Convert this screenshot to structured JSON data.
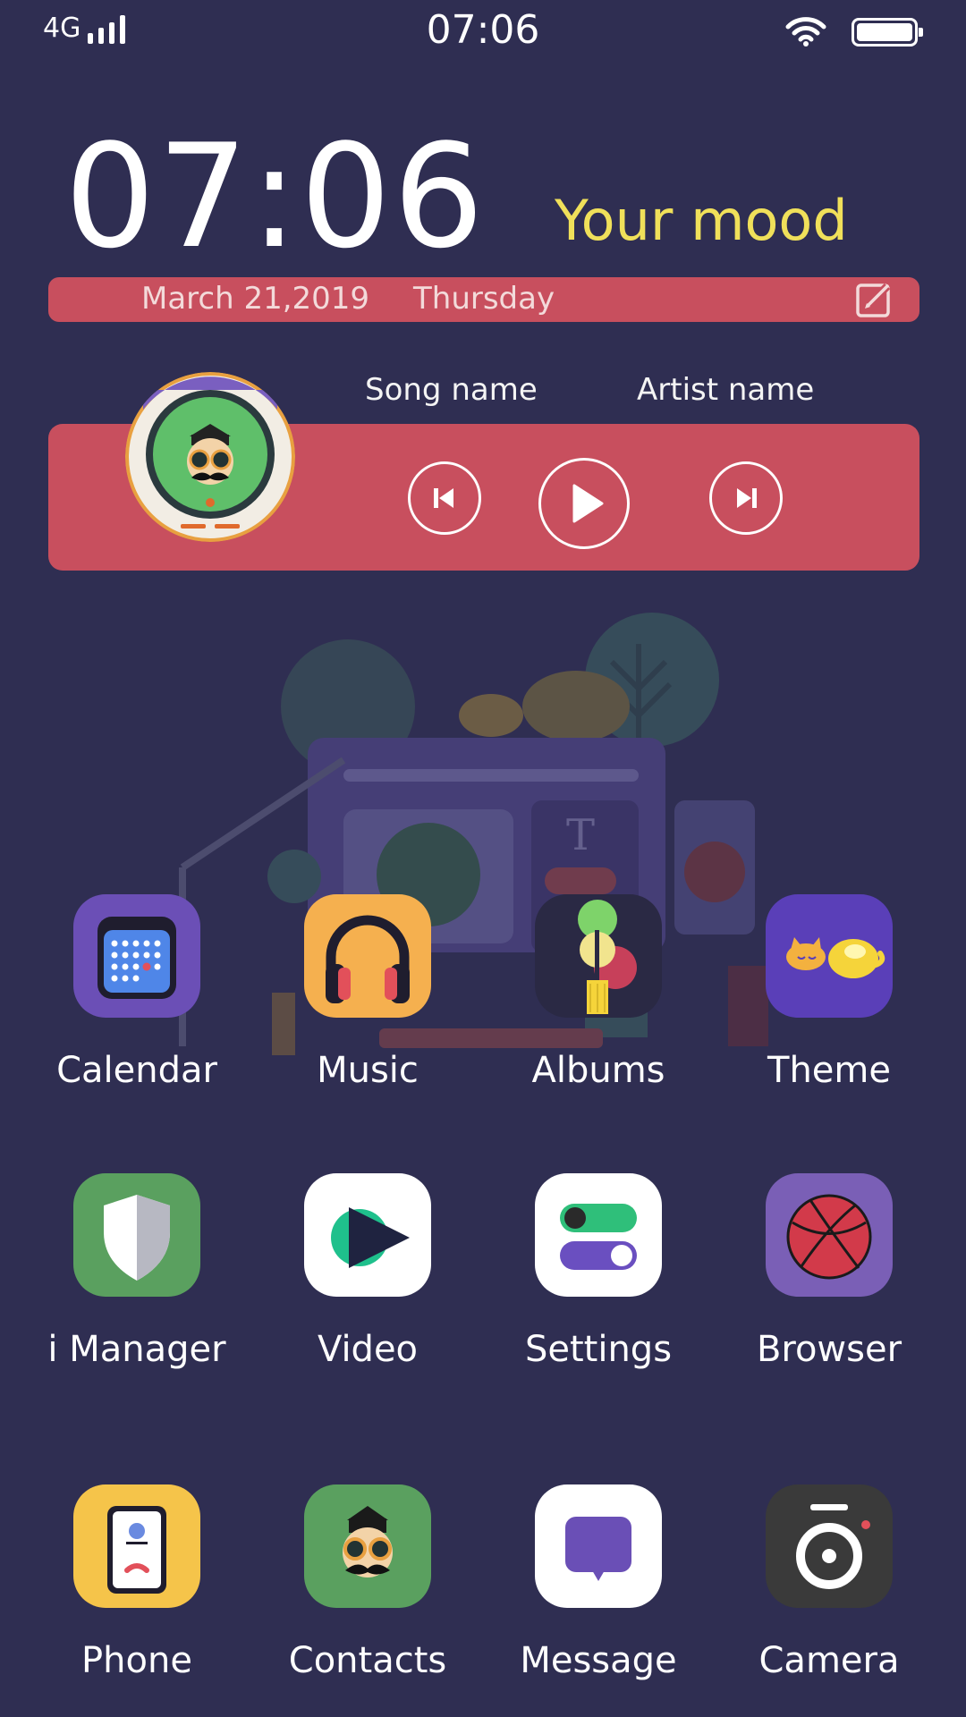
{
  "status_bar": {
    "network": "4G",
    "time": "07:06"
  },
  "clock_widget": {
    "time": "07:06",
    "mood": "Your mood",
    "date": "March 21,2019",
    "day": "Thursday"
  },
  "music_widget": {
    "song": "Song name",
    "artist": "Artist name"
  },
  "colors": {
    "background": "#2f2e52",
    "widget_red": "#c84f5e",
    "mood_yellow": "#f0e05a"
  },
  "apps": [
    {
      "label": "Calendar"
    },
    {
      "label": "Music"
    },
    {
      "label": "Albums"
    },
    {
      "label": "Theme"
    },
    {
      "label": "i Manager"
    },
    {
      "label": "Video"
    },
    {
      "label": "Settings"
    },
    {
      "label": "Browser"
    },
    {
      "label": "Phone"
    },
    {
      "label": "Contacts"
    },
    {
      "label": "Message"
    },
    {
      "label": "Camera"
    }
  ]
}
